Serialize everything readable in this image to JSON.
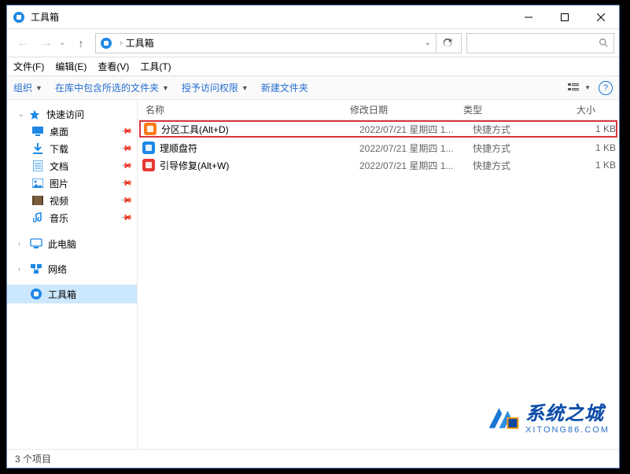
{
  "titlebar": {
    "title": "工具箱"
  },
  "address": {
    "location": "工具箱",
    "search_placeholder": ""
  },
  "menubar": {
    "file": "文件(F)",
    "edit": "编辑(E)",
    "view": "查看(V)",
    "tools": "工具(T)"
  },
  "toolbar": {
    "organize": "组织",
    "include": "在库中包含所选的文件夹",
    "grant": "授予访问权限",
    "newfolder": "新建文件夹"
  },
  "sidebar": {
    "quickaccess": {
      "label": "快速访问"
    },
    "items": [
      {
        "key": "desktop",
        "label": "桌面",
        "color": "#1e88e5"
      },
      {
        "key": "downloads",
        "label": "下载",
        "color": "#1e88e5"
      },
      {
        "key": "documents",
        "label": "文档",
        "color": "#1e88e5"
      },
      {
        "key": "pictures",
        "label": "图片",
        "color": "#1e88e5"
      },
      {
        "key": "videos",
        "label": "视频",
        "color": "#7b5d3b"
      },
      {
        "key": "music",
        "label": "音乐",
        "color": "#1e88e5"
      }
    ],
    "thispc": "此电脑",
    "network": "网络",
    "toolbox": "工具箱"
  },
  "columns": {
    "name": "名称",
    "date": "修改日期",
    "type": "类型",
    "size": "大小"
  },
  "files": [
    {
      "name": "分区工具(Alt+D)",
      "date": "2022/07/21 星期四 1...",
      "type": "快捷方式",
      "size": "1 KB",
      "icon_bg": "#ff7b1a",
      "highlight": true
    },
    {
      "name": "理顺盘符",
      "date": "2022/07/21 星期四 1...",
      "type": "快捷方式",
      "size": "1 KB",
      "icon_bg": "#1e88e5",
      "highlight": false
    },
    {
      "name": "引导修复(Alt+W)",
      "date": "2022/07/21 星期四 1...",
      "type": "快捷方式",
      "size": "1 KB",
      "icon_bg": "#e53935",
      "highlight": false
    }
  ],
  "statusbar": {
    "count": "3 个项目"
  },
  "watermark": {
    "title": "系统之城",
    "sub": "XITONG86.COM"
  }
}
